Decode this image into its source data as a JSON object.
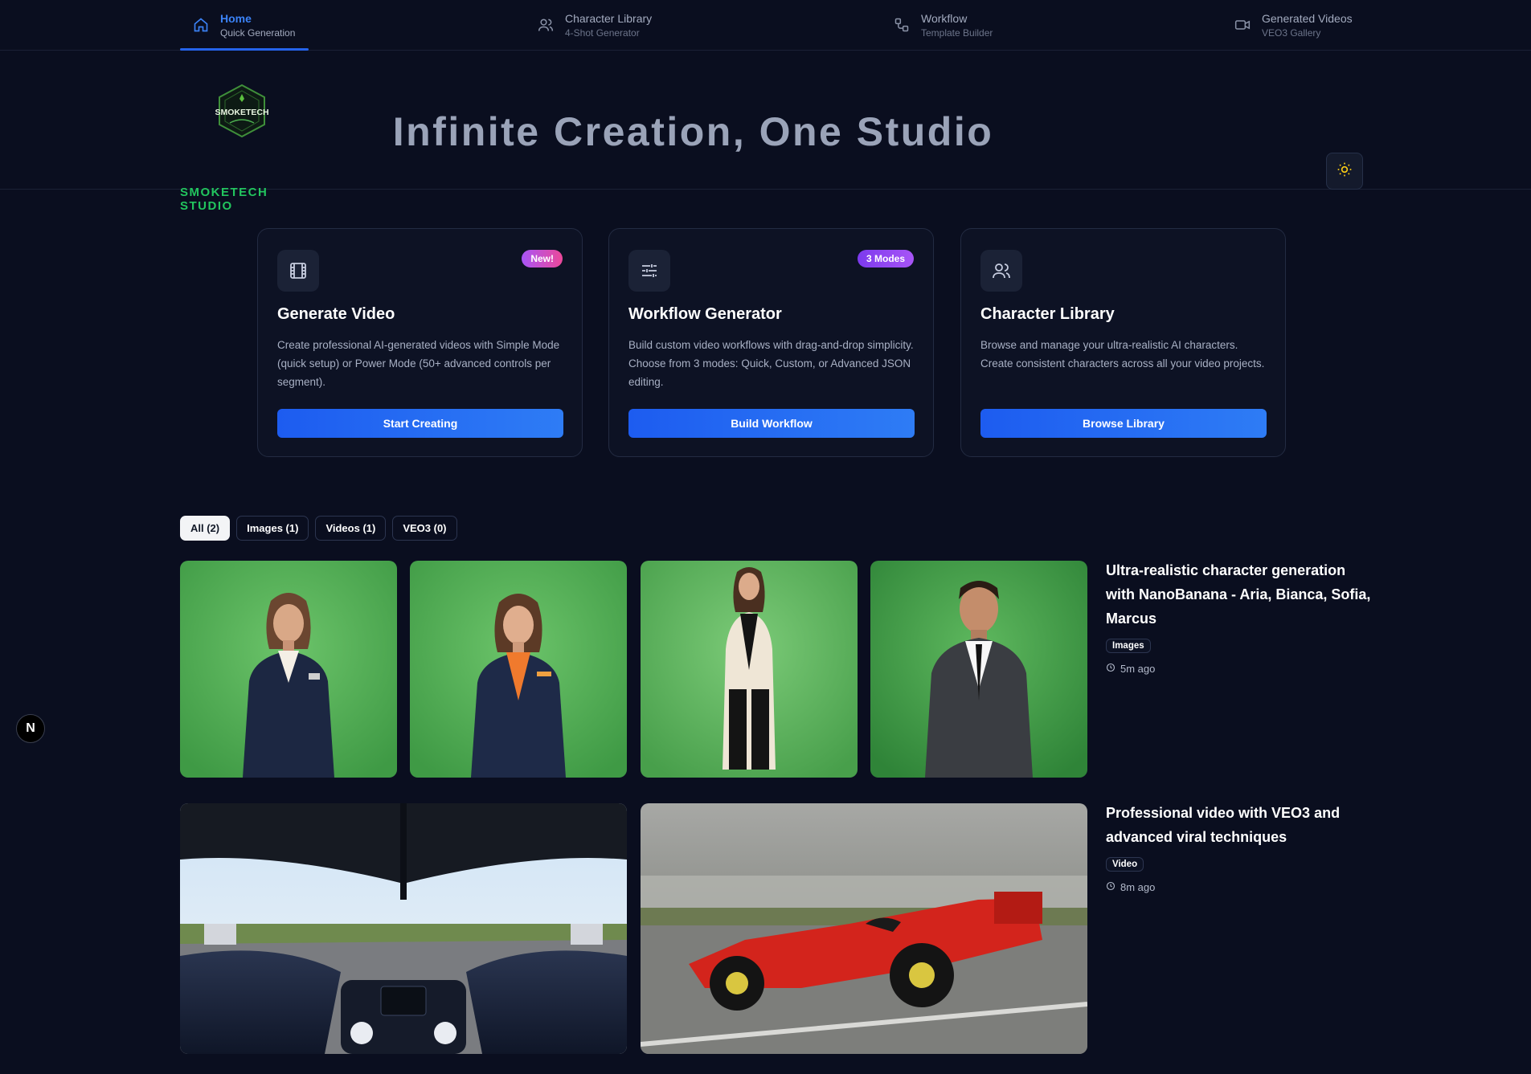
{
  "nav": [
    {
      "title": "Home",
      "subtitle": "Quick Generation",
      "icon": "home-icon",
      "active": true
    },
    {
      "title": "Character Library",
      "subtitle": "4-Shot Generator",
      "icon": "users-icon"
    },
    {
      "title": "Workflow",
      "subtitle": "Template Builder",
      "icon": "workflow-icon"
    },
    {
      "title": "Generated Videos",
      "subtitle": "VEO3 Gallery",
      "icon": "video-icon"
    }
  ],
  "brand": {
    "name": "SMOKETECH STUDIO",
    "logo_text": "SMOKETECH"
  },
  "hero": {
    "title": "Infinite Creation, One Studio"
  },
  "cards": [
    {
      "icon": "film-icon",
      "badge": "New!",
      "title": "Generate Video",
      "description": "Create professional AI-generated videos with Simple Mode (quick setup) or Power Mode (50+ advanced controls per segment).",
      "button": "Start Creating"
    },
    {
      "icon": "sliders-icon",
      "badge": "3 Modes",
      "title": "Workflow Generator",
      "description": "Build custom video workflows with drag-and-drop simplicity. Choose from 3 modes: Quick, Custom, or Advanced JSON editing.",
      "button": "Build Workflow"
    },
    {
      "icon": "users-icon",
      "badge": "",
      "title": "Character Library",
      "description": "Browse and manage your ultra-realistic AI characters. Create consistent characters across all your video projects.",
      "button": "Browse Library"
    }
  ],
  "filters": [
    "All (2)",
    "Images (1)",
    "Videos (1)",
    "VEO3 (0)"
  ],
  "items": [
    {
      "title": "Ultra-realistic character generation with NanoBanana - Aria, Bianca, Sofia, Marcus",
      "tag": "Images",
      "time": "5m ago"
    },
    {
      "title": "Professional video with VEO3 and advanced viral techniques",
      "tag": "Video",
      "time": "8m ago"
    }
  ],
  "dev_badge": "N",
  "colors": {
    "accent": "#2563eb",
    "brand_green": "#22c55e",
    "background": "#0a0e1f"
  }
}
